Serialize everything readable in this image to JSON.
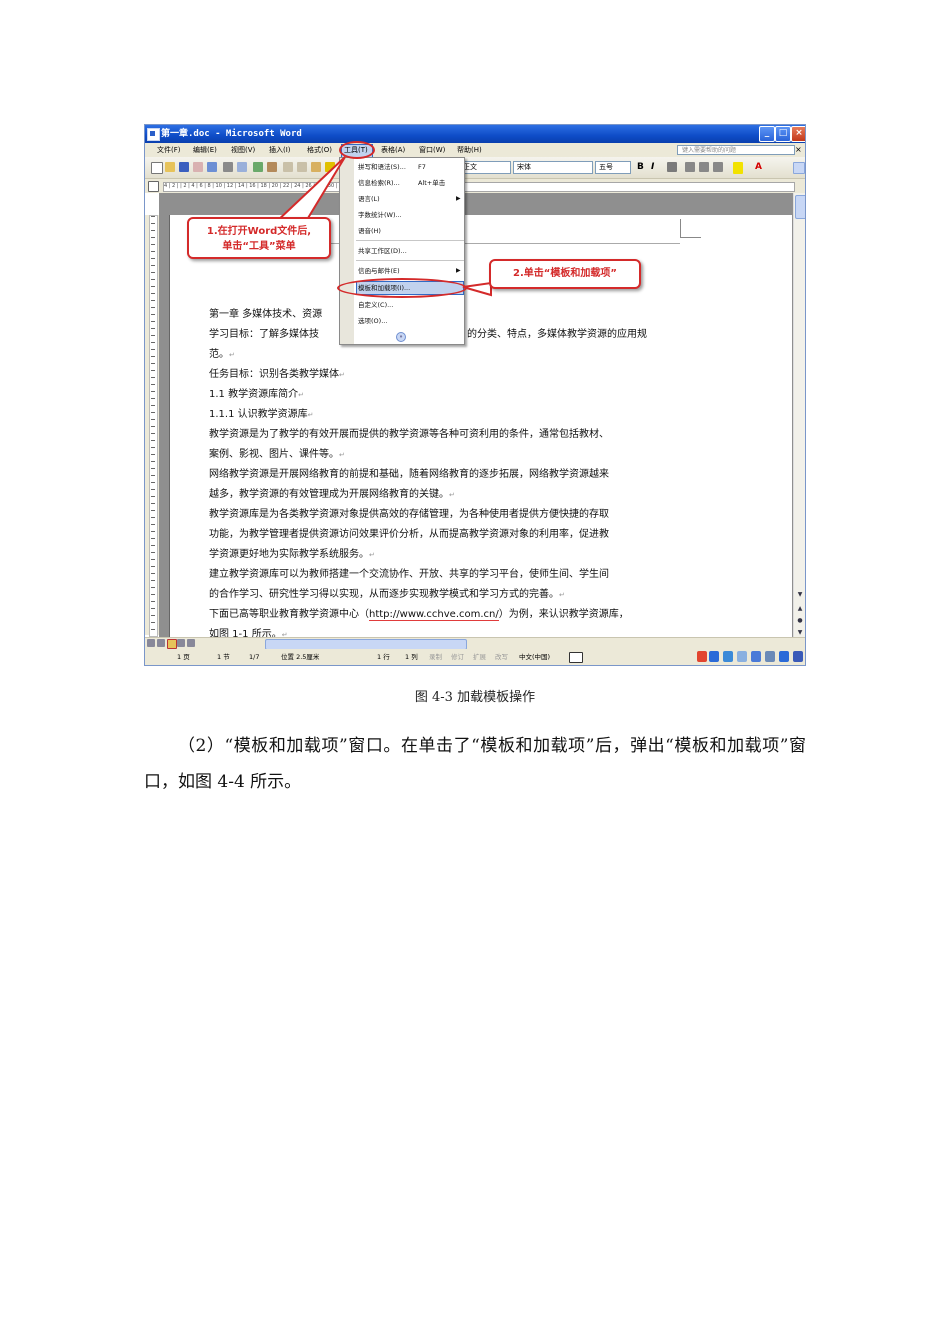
{
  "window": {
    "title": "第一章.doc - Microsoft Word",
    "min_label": "_",
    "max_label": "□",
    "close_label": "×"
  },
  "menubar": {
    "items": [
      "文件(F)",
      "编辑(E)",
      "视图(V)",
      "插入(I)",
      "格式(O)",
      "工具(T)",
      "表格(A)",
      "窗口(W)",
      "帮助(H)"
    ],
    "help_placeholder": "键入需要帮助的问题",
    "help_close": "×"
  },
  "toolbar": {
    "style_value": "正文",
    "font_value": "宋体",
    "size_value": "五号",
    "bold": "B",
    "italic": "I",
    "font_color": "A"
  },
  "ruler": {
    "text": "4 | 2 |   | 2 | 4 | 6 | 8 | 10 | 12 | 14 | 16 | 18 | 20 | 22 | 24 | 26 | 28 | 30 | 32 | 34 | 36 | 38 | 40 | 42 | 44 | 46 | 48"
  },
  "tools_menu": {
    "items": [
      {
        "label": "拼写和语法(S)...",
        "shortcut": "F7",
        "arrow": ""
      },
      {
        "label": "信息检索(R)...",
        "shortcut": "Alt+单击",
        "arrow": ""
      },
      {
        "label": "语言(L)",
        "shortcut": "",
        "arrow": "▶"
      },
      {
        "label": "字数统计(W)...",
        "shortcut": "",
        "arrow": ""
      },
      {
        "label": "语音(H)",
        "shortcut": "",
        "arrow": ""
      },
      {
        "label": "共享工作区(D)...",
        "shortcut": "",
        "arrow": ""
      },
      {
        "label": "信函与邮件(E)",
        "shortcut": "",
        "arrow": "▶"
      },
      {
        "label": "模板和加载项(I)...",
        "shortcut": "",
        "arrow": ""
      },
      {
        "label": "自定义(C)...",
        "shortcut": "",
        "arrow": ""
      },
      {
        "label": "选项(O)...",
        "shortcut": "",
        "arrow": ""
      }
    ],
    "more_icon": "double-chevron-down-icon",
    "more_label": "»"
  },
  "annotations": {
    "callout1_line1": "1.在打开Word文件后,",
    "callout1_line2": "单击“工具”菜单",
    "callout2": "2.单击“模板和加载项”",
    "color": "#d42a2a"
  },
  "document": {
    "lines": [
      "第一章  多媒体技术、资源",
      "学习目标：了解多媒体技",
      "的分类、特点，多媒体教学资源的应用规",
      "范。",
      "任务目标：识别各类教学媒体",
      "1.1 教学资源库简介",
      "1.1.1 认识教学资源库",
      "教学资源是为了教学的有效开展而提供的教学资源等各种可资利用的条件，通常包括教材、",
      "案例、影视、图片、课件等。",
      "网络教学资源是开展网络教育的前提和基础，随着网络教育的逐步拓展，网络教学资源越来",
      "越多，教学资源的有效管理成为开展网络教育的关键。",
      "教学资源库是为各类教学资源对象提供高效的存储管理，为各种使用者提供方便快捷的存取",
      "功能，为教学管理者提供资源访问效果评价分析，从而提高教学资源对象的利用率，促进教",
      "学资源更好地为实际教学系统服务。",
      "建立教学资源库可以为教师搭建一个交流协作、开放、共享的学习平台，使师生间、学生间",
      "的合作学习、研究性学习得以实现，从而逐步实现教学模式和学习方式的完善。"
    ],
    "line17_pre": "下面已高等职业教育教学资源中心（",
    "line17_url": "http://www.cchve.com.cn/",
    "line17_post": "）为例，来认识教学资源库，",
    "line18": "如图 1-1 所示。",
    "para_mark": "↵"
  },
  "statusbar": {
    "page": "1 页",
    "section": "1 节",
    "pages": "1/7",
    "position": "位置 2.5厘米",
    "row": "1 行",
    "col": "1 列",
    "rec": "录制",
    "trk": "修订",
    "ext": "扩展",
    "ovr": "改写",
    "lang": "中文(中国)"
  },
  "caption": "图 4-3  加载模板操作",
  "paragraph": "（2）“模板和加载项”窗口。在单击了“模板和加载项”后，弹出“模板和加载项”窗口，如图 4-4 所示。"
}
